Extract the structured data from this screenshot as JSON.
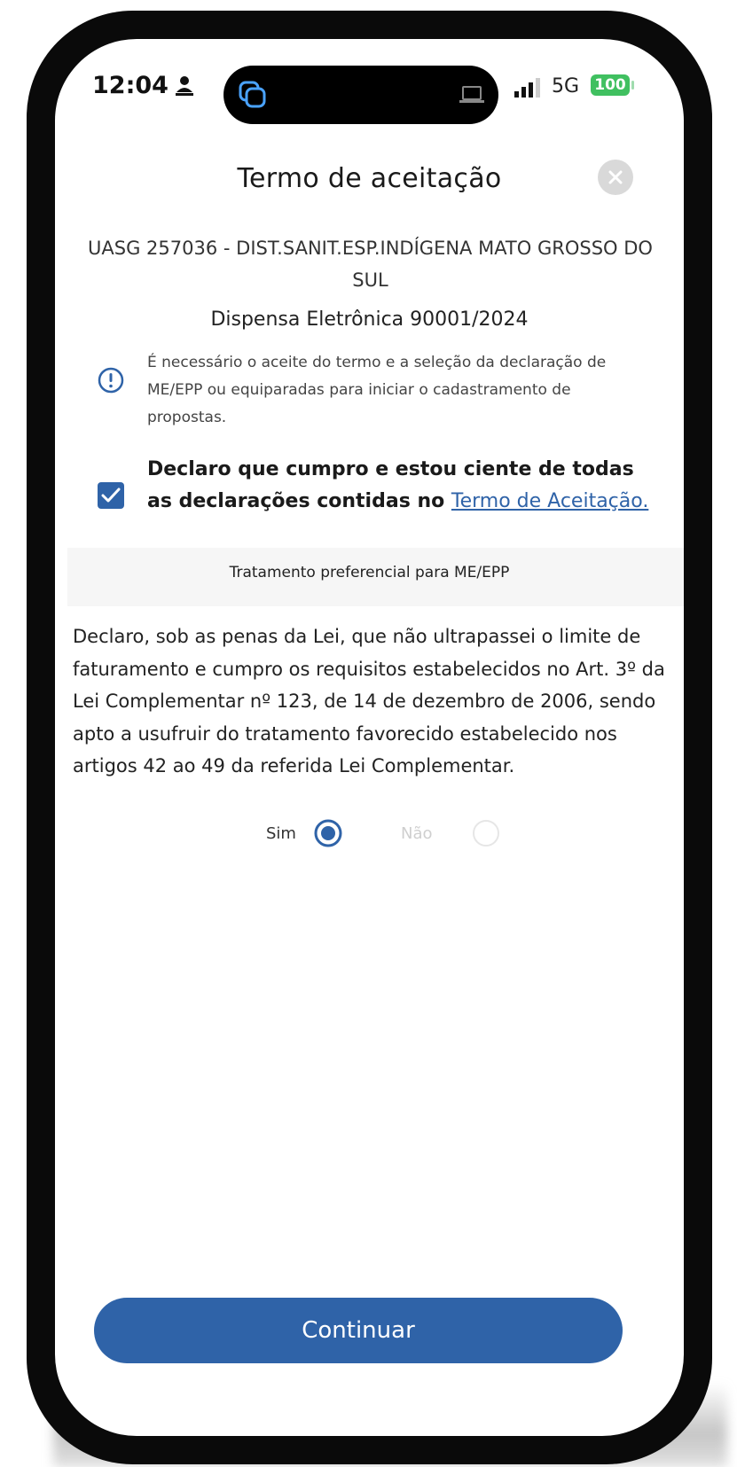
{
  "status_bar": {
    "time": "12:04",
    "network": "5G",
    "battery": "100"
  },
  "modal": {
    "title": "Termo de aceitação",
    "uasg": "UASG 257036 - DIST.SANIT.ESP.INDÍGENA MATO GROSSO DO SUL",
    "dispensa": "Dispensa Eletrônica 90001/2024",
    "info": "É necessário o aceite do termo e a seleção da declaração de ME/EPP ou equiparadas para iniciar o cadastramento de propostas.",
    "declaration": {
      "text": "Declaro que cumpro e estou ciente de todas as declarações contidas no ",
      "link": "Termo de Aceitação.",
      "checked": true
    },
    "section_title": "Tratamento preferencial para ME/EPP",
    "body": "Declaro, sob as penas da Lei, que não ultrapassei o limite de faturamento e cumpro os requisitos estabelecidos no Art. 3º da Lei Complementar nº 123, de 14 de dezembro de 2006, sendo apto a usufruir do tratamento favorecido estabelecido nos artigos 42 ao 49 da referida Lei Complementar.",
    "options": {
      "yes_label": "Sim",
      "no_label": "Não",
      "selected": "Sim"
    },
    "continue_label": "Continuar"
  },
  "colors": {
    "primary": "#2f63a8",
    "battery": "#40c060"
  },
  "icons": [
    "person-icon",
    "overlapping-cards-icon",
    "laptop-icon",
    "signal-bars-icon",
    "close-icon",
    "info-icon",
    "checkmark-icon"
  ]
}
